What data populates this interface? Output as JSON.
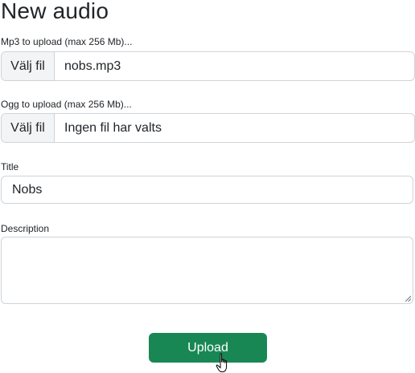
{
  "page": {
    "title": "New audio"
  },
  "mp3": {
    "label": "Mp3 to upload (max 256 Mb)...",
    "button_label": "Välj fil",
    "file_name": "nobs.mp3"
  },
  "ogg": {
    "label": "Ogg to upload (max 256 Mb)...",
    "button_label": "Välj fil",
    "file_name": "Ingen fil har valts"
  },
  "title_field": {
    "label": "Title",
    "value": "Nobs"
  },
  "description_field": {
    "label": "Description",
    "value": ""
  },
  "upload": {
    "label": "Upload"
  },
  "colors": {
    "primary_button": "#198754",
    "input_border": "#ced4da",
    "file_button_bg": "#f3f4f6"
  },
  "icons": {
    "cursor": "hand-pointer-icon",
    "resize": "resize-grip-icon"
  }
}
